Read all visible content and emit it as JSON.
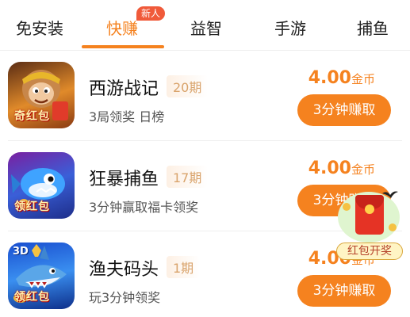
{
  "tabs": [
    {
      "label": "免安装"
    },
    {
      "label": "快赚",
      "badge": "新人",
      "active": true
    },
    {
      "label": "益智"
    },
    {
      "label": "手游"
    },
    {
      "label": "捕鱼"
    }
  ],
  "games": [
    {
      "name": "西游战记",
      "period": "20期",
      "desc": "3局领奖 日榜",
      "reward_amount": "4.00",
      "reward_unit": "金币",
      "button": "3分钟赚取",
      "icon": "monkey-king-game-icon",
      "icon_label": "奇红包"
    },
    {
      "name": "狂暴捕鱼",
      "period": "17期",
      "desc": "3分钟赢取福卡领奖",
      "reward_amount": "4.00",
      "reward_unit": "金币",
      "button": "3分钟赚取",
      "icon": "blue-fish-game-icon",
      "icon_label": "领红包"
    },
    {
      "name": "渔夫码头",
      "period": "1期",
      "desc": "玩3分钟领奖",
      "reward_amount": "4.00",
      "reward_unit": "金币",
      "button": "3分钟赚取",
      "icon": "shark-game-icon",
      "icon_label": "领红包",
      "icon_tag": "3D"
    }
  ],
  "float_widget": {
    "label": "红包开奖",
    "icon": "red-envelope-icon"
  },
  "colors": {
    "accent": "#f5821f",
    "badge": "#f05a3a",
    "period_text": "#d9a36b"
  }
}
